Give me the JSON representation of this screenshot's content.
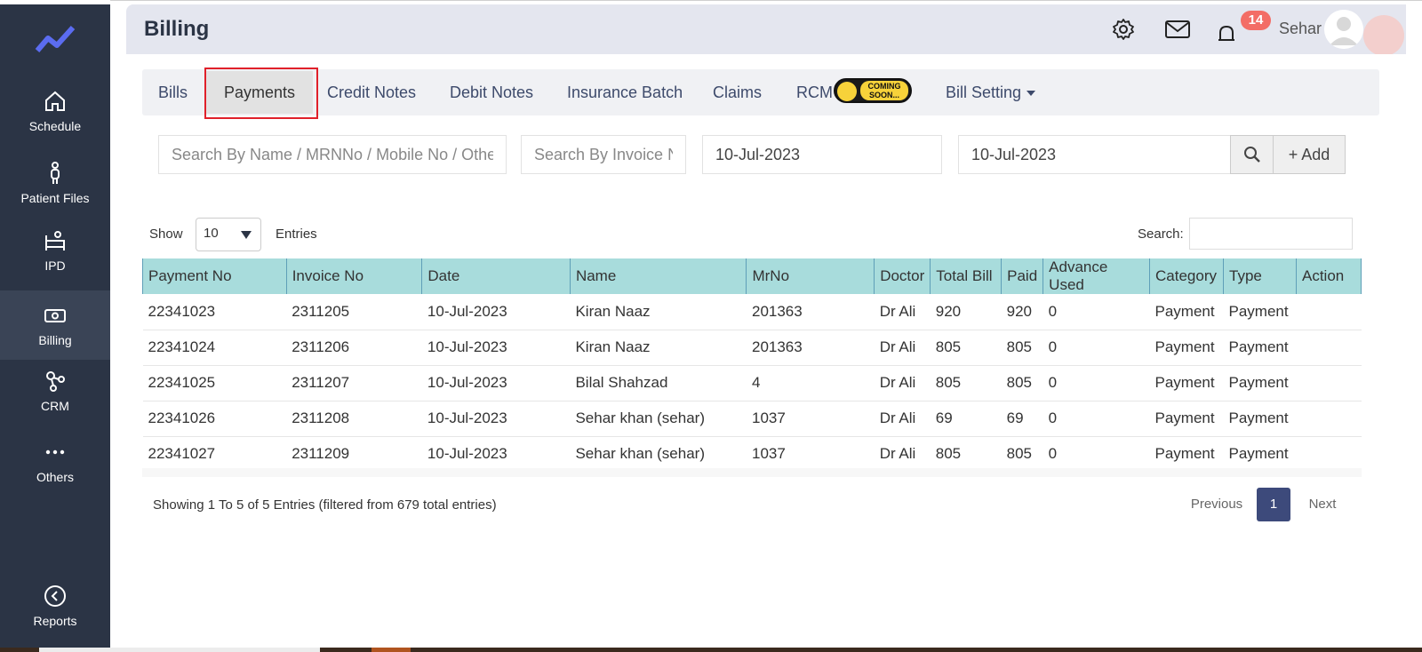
{
  "sidebar": {
    "items": [
      {
        "label": "Schedule",
        "icon": "home-icon"
      },
      {
        "label": "Patient Files",
        "icon": "person-icon"
      },
      {
        "label": "IPD",
        "icon": "bed-icon"
      },
      {
        "label": "Billing",
        "icon": "money-icon"
      },
      {
        "label": "CRM",
        "icon": "network-icon"
      },
      {
        "label": "Others",
        "icon": "more-icon"
      },
      {
        "label": "Reports",
        "icon": "chevron-left-circle-icon"
      }
    ],
    "active": "Billing",
    "bg_color": "#2b3445",
    "accent_color": "#5b6cf0"
  },
  "header": {
    "title": "Billing",
    "notification_count": "14",
    "user_name": "Sehar"
  },
  "tabs": {
    "bills": "Bills",
    "payments": "Payments",
    "credit_notes": "Credit Notes",
    "debit_notes": "Debit Notes",
    "insurance_batch": "Insurance Batch",
    "claims": "Claims",
    "rcm": "RCM",
    "coming_soon": "COMING SOON...",
    "bill_setting": "Bill Setting",
    "active": "Payments"
  },
  "filters": {
    "name_placeholder": "Search By Name / MRNNo / Mobile No / Other Fields",
    "invoice_placeholder": "Search By Invoice No",
    "date_from": "10-Jul-2023",
    "date_to": "10-Jul-2023",
    "add_label": "+ Add"
  },
  "table_controls": {
    "show_label": "Show",
    "entries_value": "10",
    "entries_label": "Entries",
    "search_label": "Search:"
  },
  "table": {
    "columns": [
      "Payment No",
      "Invoice No",
      "Date",
      "Name",
      "MrNo",
      "Doctor",
      "Total Bill",
      "Paid",
      "Advance Used",
      "Category",
      "Type",
      "Action"
    ],
    "rows": [
      [
        "22341023",
        "2311205",
        "10-Jul-2023",
        "Kiran Naaz",
        "201363",
        "Dr Ali",
        "920",
        "920",
        "0",
        "Payment",
        "Payment",
        ""
      ],
      [
        "22341024",
        "2311206",
        "10-Jul-2023",
        "Kiran Naaz",
        "201363",
        "Dr Ali",
        "805",
        "805",
        "0",
        "Payment",
        "Payment",
        ""
      ],
      [
        "22341025",
        "2311207",
        "10-Jul-2023",
        "Bilal Shahzad",
        "4",
        "Dr Ali",
        "805",
        "805",
        "0",
        "Payment",
        "Payment",
        ""
      ],
      [
        "22341026",
        "2311208",
        "10-Jul-2023",
        "Sehar khan (sehar)",
        "1037",
        "Dr Ali",
        "69",
        "69",
        "0",
        "Payment",
        "Payment",
        ""
      ],
      [
        "22341027",
        "2311209",
        "10-Jul-2023",
        "Sehar khan (sehar)",
        "1037",
        "Dr Ali",
        "805",
        "805",
        "0",
        "Payment",
        "Payment",
        ""
      ]
    ],
    "header_color": "#a8dcdc"
  },
  "footer": {
    "showing_text": "Showing 1 To 5 of 5 Entries (filtered from 679 total entries)",
    "previous": "Previous",
    "current_page": "1",
    "next": "Next"
  }
}
